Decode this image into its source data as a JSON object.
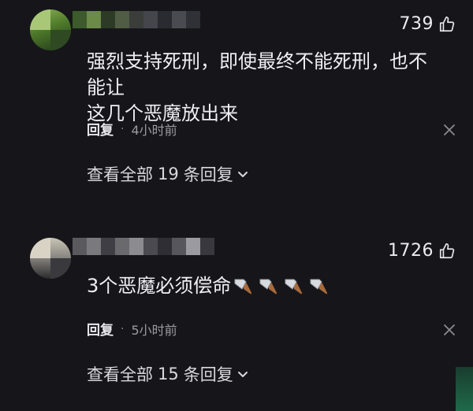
{
  "comments": [
    {
      "likes": "739",
      "text": "强烈支持死刑，即使最终不能死刑，也不能让\n这几个恶魔放出来",
      "reply_label": "回复",
      "separator": "·",
      "time": "4小时前",
      "view_replies_prefix": "查看全部",
      "reply_count": "19",
      "view_replies_suffix": "条回复"
    },
    {
      "likes": "1726",
      "text": "3个恶魔必须偿命",
      "emoji": [
        "cleaver-icon",
        "cleaver-icon",
        "cleaver-icon",
        "cleaver-icon"
      ],
      "reply_label": "回复",
      "separator": "·",
      "time": "5小时前",
      "view_replies_prefix": "查看全部",
      "reply_count": "15",
      "view_replies_suffix": "条回复"
    }
  ],
  "icons": {
    "like": "thumb-up-icon",
    "close": "close-icon",
    "expand": "chevron-down-icon"
  },
  "colors": {
    "background": "#16161a",
    "text": "#f0f0f4",
    "muted": "#9a9aa2"
  }
}
